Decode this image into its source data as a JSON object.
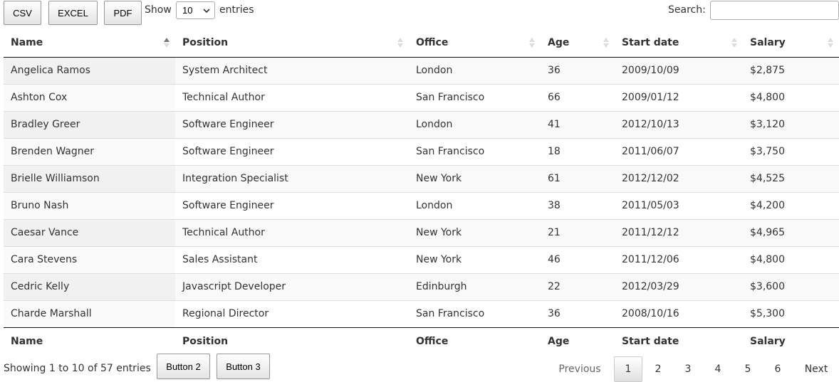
{
  "toolbar": {
    "csv_label": "CSV",
    "excel_label": "EXCEL",
    "pdf_label": "PDF"
  },
  "length": {
    "prefix": "Show",
    "selected": "10",
    "suffix": "entries"
  },
  "search": {
    "label": "Search:",
    "value": "",
    "placeholder": ""
  },
  "table": {
    "columns": [
      "Name",
      "Position",
      "Office",
      "Age",
      "Start date",
      "Salary"
    ],
    "sort": {
      "column": "Name",
      "direction": "ascending"
    },
    "rows": [
      [
        "Angelica Ramos",
        "System Architect",
        "London",
        "36",
        "2009/10/09",
        "$2,875"
      ],
      [
        "Ashton Cox",
        "Technical Author",
        "San Francisco",
        "66",
        "2009/01/12",
        "$4,800"
      ],
      [
        "Bradley Greer",
        "Software Engineer",
        "London",
        "41",
        "2012/10/13",
        "$3,120"
      ],
      [
        "Brenden Wagner",
        "Software Engineer",
        "San Francisco",
        "18",
        "2011/06/07",
        "$3,750"
      ],
      [
        "Brielle Williamson",
        "Integration Specialist",
        "New York",
        "61",
        "2012/12/02",
        "$4,525"
      ],
      [
        "Bruno Nash",
        "Software Engineer",
        "London",
        "38",
        "2011/05/03",
        "$4,200"
      ],
      [
        "Caesar Vance",
        "Technical Author",
        "New York",
        "21",
        "2011/12/12",
        "$4,965"
      ],
      [
        "Cara Stevens",
        "Sales Assistant",
        "New York",
        "46",
        "2011/12/06",
        "$4,800"
      ],
      [
        "Cedric Kelly",
        "Javascript Developer",
        "Edinburgh",
        "22",
        "2012/03/29",
        "$3,600"
      ],
      [
        "Charde Marshall",
        "Regional Director",
        "San Francisco",
        "36",
        "2008/10/16",
        "$5,300"
      ]
    ]
  },
  "footer": {
    "info": "Showing 1 to 10 of 57 entries",
    "button2_label": "Button 2",
    "button3_label": "Button 3"
  },
  "pagination": {
    "previous": "Previous",
    "pages": [
      "1",
      "2",
      "3",
      "4",
      "5",
      "6"
    ],
    "current": "1",
    "next": "Next"
  }
}
